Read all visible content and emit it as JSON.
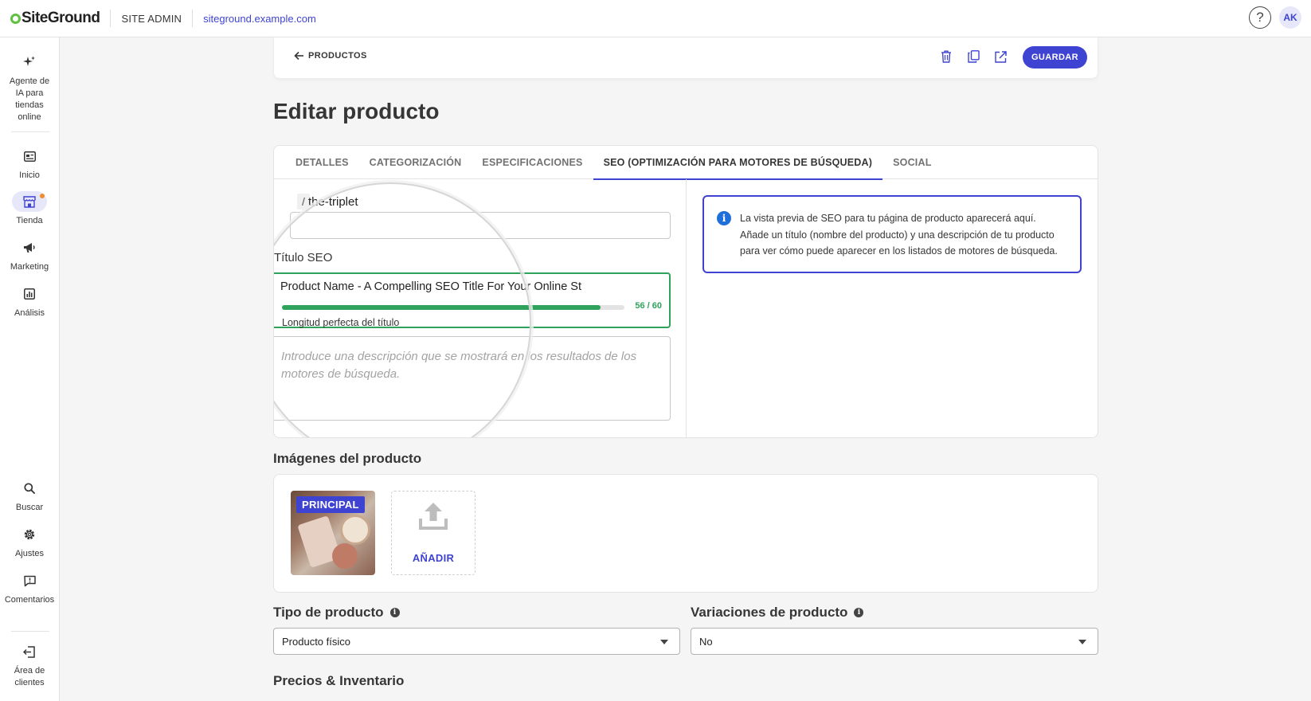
{
  "topbar": {
    "logo": "SiteGround",
    "section": "SITE ADMIN",
    "site_url": "siteground.example.com",
    "help_icon": "question-icon",
    "avatar_initials": "AK"
  },
  "sidebar": {
    "items": [
      {
        "label": "Agente de IA para tiendas online",
        "icon": "sparkles-icon"
      },
      {
        "label": "Inicio",
        "icon": "dashboard-icon"
      },
      {
        "label": "Tienda",
        "icon": "store-icon",
        "active": true
      },
      {
        "label": "Marketing",
        "icon": "megaphone-icon"
      },
      {
        "label": "Análisis",
        "icon": "chart-icon"
      }
    ],
    "bottom_items": [
      {
        "label": "Buscar",
        "icon": "search-icon"
      },
      {
        "label": "Ajustes",
        "icon": "gear-icon"
      },
      {
        "label": "Comentarios",
        "icon": "comment-icon"
      },
      {
        "label": "Área de clientes",
        "icon": "exit-icon"
      }
    ]
  },
  "action_bar": {
    "back_label": "PRODUCTOS",
    "save_label": "GUARDAR"
  },
  "page_title": "Editar producto",
  "tabs": [
    {
      "label": "DETALLES",
      "active": false
    },
    {
      "label": "CATEGORIZACIÓN",
      "active": false
    },
    {
      "label": "ESPECIFICACIONES",
      "active": false
    },
    {
      "label": "SEO (OPTIMIZACIÓN PARA MOTORES DE BÚSQUEDA)",
      "active": true
    },
    {
      "label": "SOCIAL",
      "active": false
    }
  ],
  "seo": {
    "slug_prefix": "/",
    "slug_value": "the-triplet",
    "title_label": "Título SEO",
    "title_value": "Product Name - A Compelling SEO Title For Your Online St",
    "title_count": "56 / 60",
    "title_progress": 0.93,
    "title_hint": "Longitud perfecta del título",
    "description_placeholder": "Introduce una descripción que se mostrará en los resultados de los motores de búsqueda.",
    "preview_info": "La vista previa de SEO para tu página de producto aparecerá aquí. Añade un título (nombre del producto) y una descripción de tu producto para ver cómo puede aparecer en los listados de motores de búsqueda."
  },
  "images": {
    "section_title": "Imágenes del producto",
    "principal_badge": "PRINCIPAL",
    "add_label": "AÑADIR"
  },
  "product_type": {
    "label": "Tipo de producto",
    "value": "Producto físico"
  },
  "variations": {
    "label": "Variaciones de producto",
    "value": "No"
  },
  "pricing": {
    "section_title": "Precios & Inventario"
  },
  "colors": {
    "accent": "#3f43d2",
    "success": "#2fa35b",
    "info": "#1e6fd9",
    "notification": "#f08c2e"
  }
}
